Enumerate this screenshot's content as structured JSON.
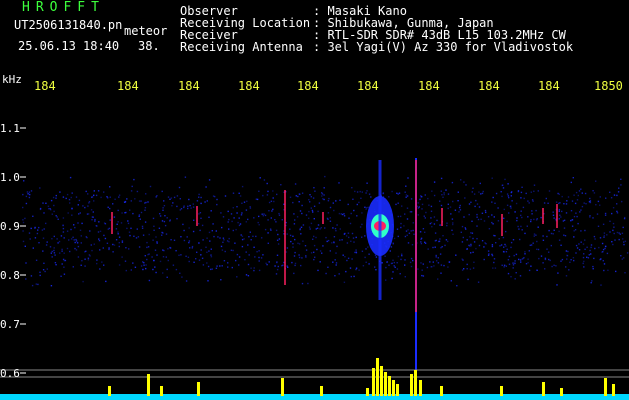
{
  "header": {
    "logo": "HROFFT",
    "filename": "UT2506131840.pn",
    "mode": "meteor",
    "datetime": "25.06.13 18:40",
    "count": "38.",
    "info_labels": [
      "Observer",
      "Receiving Location",
      "Receiver",
      "Receiving Antenna"
    ],
    "info_values": [
      ": Masaki Kano",
      ": Shibukawa, Gunma, Japan",
      ": RTL-SDR SDR# 43dB L15 103.2MHz CW",
      ": 3el Yagi(V) Az 330 for Vladivostok"
    ]
  },
  "axis": {
    "unit": "kHz",
    "time_ticks": [
      "184",
      "184",
      "184",
      "184",
      "184",
      "184",
      "184",
      "184",
      "184",
      "1850"
    ],
    "freq_ticks": [
      "1.1",
      "1.0",
      "0.9",
      "0.8",
      "0.7",
      "0.6"
    ],
    "freq_values": [
      1.1,
      1.0,
      0.9,
      0.8,
      0.7,
      0.6
    ],
    "freq_range": [
      0.58,
      1.15
    ]
  },
  "colors": {
    "background": "#000000",
    "text": "#ffffff",
    "logo": "#3cff3c",
    "ticks": "#f0ff40",
    "noise": "#1a2cff",
    "echo_core": "#ff2060",
    "echo_mid": "#30ffc8",
    "bars": "#ffff00",
    "baseline": "#00d8ff"
  }
}
